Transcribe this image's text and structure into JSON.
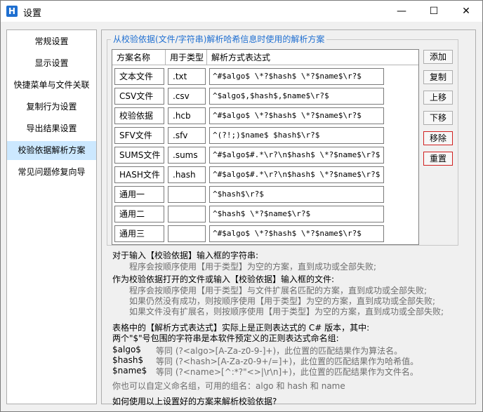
{
  "window": {
    "title": "设置",
    "app_icon_letter": "H",
    "minimize": "—",
    "maximize": "☐",
    "close": "✕"
  },
  "sidebar": {
    "items": [
      {
        "label": "常规设置"
      },
      {
        "label": "显示设置"
      },
      {
        "label": "快捷菜单与文件关联"
      },
      {
        "label": "复制行为设置"
      },
      {
        "label": "导出结果设置"
      },
      {
        "label": "校验依据解析方案",
        "active": true
      },
      {
        "label": "常见问题修复向导"
      }
    ]
  },
  "group_title": "从校验依据(文件/字符串)解析哈希信息时使用的解析方案",
  "grid": {
    "headers": [
      "方案名称",
      "用于类型",
      "解析方式表达式"
    ],
    "rows": [
      {
        "name": "文本文件",
        "type": ".txt",
        "expr": "^#$algo$ \\*?$hash$ \\*?$name$\\r?$"
      },
      {
        "name": "CSV文件",
        "type": ".csv",
        "expr": "^$algo$,$hash$,$name$\\r?$"
      },
      {
        "name": "校验依据",
        "type": ".hcb",
        "expr": "^#$algo$ \\*?$hash$ \\*?$name$\\r?$"
      },
      {
        "name": "SFV文件",
        "type": ".sfv",
        "expr": "^(?!;)$name$ $hash$\\r?$"
      },
      {
        "name": "SUMS文件",
        "type": ".sums",
        "expr": "^#$algo$#.*\\r?\\n$hash$ \\*?$name$\\r?$"
      },
      {
        "name": "HASH文件",
        "type": ".hash",
        "expr": "^#$algo$#.*\\r?\\n$hash$ \\*?$name$\\r?$"
      },
      {
        "name": "通用一",
        "type": "",
        "expr": "^$hash$\\r?$"
      },
      {
        "name": "通用二",
        "type": "",
        "expr": "^$hash$ \\*?$name$\\r?$"
      },
      {
        "name": "通用三",
        "type": "",
        "expr": "^#$algo$ \\*?$hash$ \\*?$name$\\r?$"
      }
    ]
  },
  "buttons": {
    "add": "添加",
    "copy": "复制",
    "up": "上移",
    "down": "下移",
    "remove": "移除",
    "reset": "重置"
  },
  "help": {
    "p1_title": "对于输入【校验依据】输入框的字符串:",
    "p1_l1": "程序会按顺序使用【用于类型】为空的方案，直到成功或全部失败;",
    "p2_title": "作为校验依据打开的文件或输入【校验依据】输入框的文件:",
    "p2_l1": "程序会按顺序使用【用于类型】与文件扩展名匹配的方案，直到成功或全部失败;",
    "p2_l2": "如果仍然没有成功，则按顺序使用【用于类型】为空的方案，直到成功或全部失败;",
    "p2_l3": "如果文件没有扩展名，则按顺序使用【用于类型】为空的方案，直到成功或全部失败;",
    "p3_title": "表格中的【解析方式表达式】实际上是正则表达式的 C# 版本，其中:",
    "p3_sub": "两个\"$\"号包围的字符串是本软件预定义的正则表达式命名组:",
    "algo_key": "$algo$",
    "algo_desc": "等同 (?<algo>[A-Za-z0-9-]+)，此位置的匹配结果作为算法名。",
    "hash_key": "$hash$",
    "hash_desc": "等同 (?<hash>[A-Za-z0-9+/=]+)，此位置的匹配结果作为哈希值。",
    "name_key": "$name$",
    "name_desc": "等同 (?<name>[^:*?\"<>|\\r\\n]+)，此位置的匹配结果作为文件名。",
    "custom": "你也可以自定义命名组，可用的组名：algo 和 hash 和 name",
    "last": "如何使用以上设置好的方案来解析校验依据?"
  }
}
